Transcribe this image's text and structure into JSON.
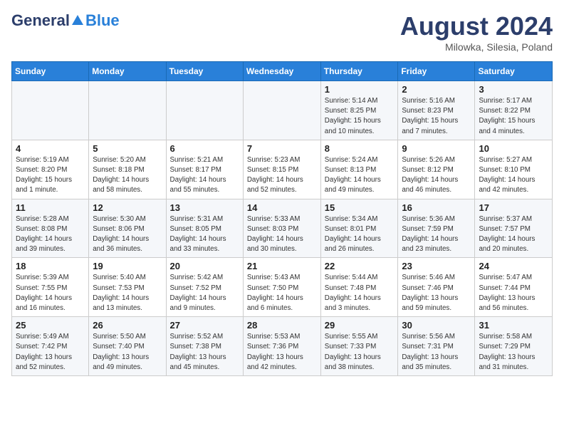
{
  "logo": {
    "general": "General",
    "blue": "Blue"
  },
  "title": "August 2024",
  "subtitle": "Milowka, Silesia, Poland",
  "days_of_week": [
    "Sunday",
    "Monday",
    "Tuesday",
    "Wednesday",
    "Thursday",
    "Friday",
    "Saturday"
  ],
  "weeks": [
    [
      {
        "day": "",
        "info": ""
      },
      {
        "day": "",
        "info": ""
      },
      {
        "day": "",
        "info": ""
      },
      {
        "day": "",
        "info": ""
      },
      {
        "day": "1",
        "info": "Sunrise: 5:14 AM\nSunset: 8:25 PM\nDaylight: 15 hours\nand 10 minutes."
      },
      {
        "day": "2",
        "info": "Sunrise: 5:16 AM\nSunset: 8:23 PM\nDaylight: 15 hours\nand 7 minutes."
      },
      {
        "day": "3",
        "info": "Sunrise: 5:17 AM\nSunset: 8:22 PM\nDaylight: 15 hours\nand 4 minutes."
      }
    ],
    [
      {
        "day": "4",
        "info": "Sunrise: 5:19 AM\nSunset: 8:20 PM\nDaylight: 15 hours\nand 1 minute."
      },
      {
        "day": "5",
        "info": "Sunrise: 5:20 AM\nSunset: 8:18 PM\nDaylight: 14 hours\nand 58 minutes."
      },
      {
        "day": "6",
        "info": "Sunrise: 5:21 AM\nSunset: 8:17 PM\nDaylight: 14 hours\nand 55 minutes."
      },
      {
        "day": "7",
        "info": "Sunrise: 5:23 AM\nSunset: 8:15 PM\nDaylight: 14 hours\nand 52 minutes."
      },
      {
        "day": "8",
        "info": "Sunrise: 5:24 AM\nSunset: 8:13 PM\nDaylight: 14 hours\nand 49 minutes."
      },
      {
        "day": "9",
        "info": "Sunrise: 5:26 AM\nSunset: 8:12 PM\nDaylight: 14 hours\nand 46 minutes."
      },
      {
        "day": "10",
        "info": "Sunrise: 5:27 AM\nSunset: 8:10 PM\nDaylight: 14 hours\nand 42 minutes."
      }
    ],
    [
      {
        "day": "11",
        "info": "Sunrise: 5:28 AM\nSunset: 8:08 PM\nDaylight: 14 hours\nand 39 minutes."
      },
      {
        "day": "12",
        "info": "Sunrise: 5:30 AM\nSunset: 8:06 PM\nDaylight: 14 hours\nand 36 minutes."
      },
      {
        "day": "13",
        "info": "Sunrise: 5:31 AM\nSunset: 8:05 PM\nDaylight: 14 hours\nand 33 minutes."
      },
      {
        "day": "14",
        "info": "Sunrise: 5:33 AM\nSunset: 8:03 PM\nDaylight: 14 hours\nand 30 minutes."
      },
      {
        "day": "15",
        "info": "Sunrise: 5:34 AM\nSunset: 8:01 PM\nDaylight: 14 hours\nand 26 minutes."
      },
      {
        "day": "16",
        "info": "Sunrise: 5:36 AM\nSunset: 7:59 PM\nDaylight: 14 hours\nand 23 minutes."
      },
      {
        "day": "17",
        "info": "Sunrise: 5:37 AM\nSunset: 7:57 PM\nDaylight: 14 hours\nand 20 minutes."
      }
    ],
    [
      {
        "day": "18",
        "info": "Sunrise: 5:39 AM\nSunset: 7:55 PM\nDaylight: 14 hours\nand 16 minutes."
      },
      {
        "day": "19",
        "info": "Sunrise: 5:40 AM\nSunset: 7:53 PM\nDaylight: 14 hours\nand 13 minutes."
      },
      {
        "day": "20",
        "info": "Sunrise: 5:42 AM\nSunset: 7:52 PM\nDaylight: 14 hours\nand 9 minutes."
      },
      {
        "day": "21",
        "info": "Sunrise: 5:43 AM\nSunset: 7:50 PM\nDaylight: 14 hours\nand 6 minutes."
      },
      {
        "day": "22",
        "info": "Sunrise: 5:44 AM\nSunset: 7:48 PM\nDaylight: 14 hours\nand 3 minutes."
      },
      {
        "day": "23",
        "info": "Sunrise: 5:46 AM\nSunset: 7:46 PM\nDaylight: 13 hours\nand 59 minutes."
      },
      {
        "day": "24",
        "info": "Sunrise: 5:47 AM\nSunset: 7:44 PM\nDaylight: 13 hours\nand 56 minutes."
      }
    ],
    [
      {
        "day": "25",
        "info": "Sunrise: 5:49 AM\nSunset: 7:42 PM\nDaylight: 13 hours\nand 52 minutes."
      },
      {
        "day": "26",
        "info": "Sunrise: 5:50 AM\nSunset: 7:40 PM\nDaylight: 13 hours\nand 49 minutes."
      },
      {
        "day": "27",
        "info": "Sunrise: 5:52 AM\nSunset: 7:38 PM\nDaylight: 13 hours\nand 45 minutes."
      },
      {
        "day": "28",
        "info": "Sunrise: 5:53 AM\nSunset: 7:36 PM\nDaylight: 13 hours\nand 42 minutes."
      },
      {
        "day": "29",
        "info": "Sunrise: 5:55 AM\nSunset: 7:33 PM\nDaylight: 13 hours\nand 38 minutes."
      },
      {
        "day": "30",
        "info": "Sunrise: 5:56 AM\nSunset: 7:31 PM\nDaylight: 13 hours\nand 35 minutes."
      },
      {
        "day": "31",
        "info": "Sunrise: 5:58 AM\nSunset: 7:29 PM\nDaylight: 13 hours\nand 31 minutes."
      }
    ]
  ]
}
